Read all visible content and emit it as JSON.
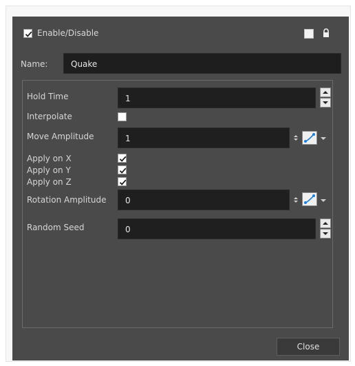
{
  "header": {
    "enable_label": "Enable/Disable",
    "enabled": true
  },
  "name_row": {
    "label": "Name:",
    "value": "Quake"
  },
  "params": [
    {
      "label": "Hold Time",
      "value": "1"
    },
    {
      "label": "Interpolate",
      "checked": false
    },
    {
      "label": "Move Amplitude",
      "value": "1"
    },
    {
      "label": "Apply on X",
      "checked": true
    },
    {
      "label": "Apply on Y",
      "checked": true
    },
    {
      "label": "Apply on Z",
      "checked": true
    },
    {
      "label": "Rotation Amplitude",
      "value": "0"
    },
    {
      "label": "Random Seed",
      "value": "0"
    }
  ],
  "buttons": {
    "close_label": "Close"
  },
  "colors": {
    "dialog_bg": "#4a4a4a",
    "field_bg": "#1f1f1f",
    "function_icon": "#1f7fd6"
  }
}
